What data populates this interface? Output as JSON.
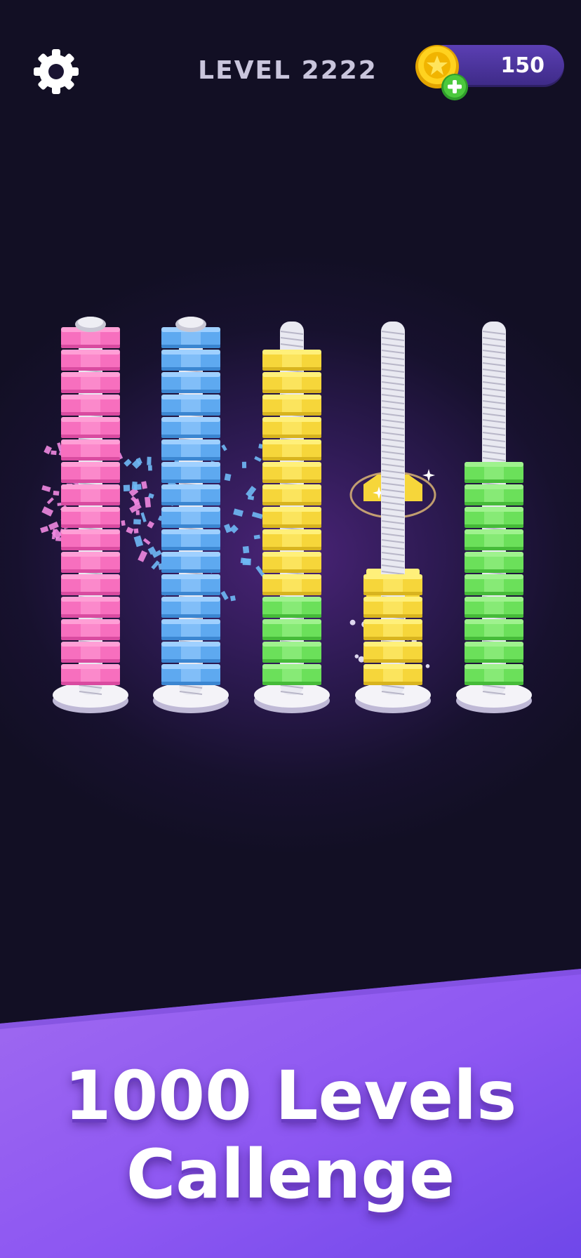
{
  "hud": {
    "level_label": "LEVEL",
    "level_number": "2222",
    "coins": "150",
    "settings_icon": "gear-icon",
    "coin_icon": "star-coin-icon",
    "add_icon": "plus-icon"
  },
  "colors": {
    "pink": "#f76fbe",
    "blue": "#5ea9f0",
    "yellow": "#f6d63a",
    "green": "#6be05a",
    "rod": "#e9e9f1"
  },
  "poles": [
    {
      "name": "pole-1",
      "stack": [
        "pink",
        "pink",
        "pink",
        "pink",
        "pink",
        "pink",
        "pink",
        "pink",
        "pink",
        "pink",
        "pink",
        "pink",
        "pink",
        "pink",
        "pink",
        "pink"
      ]
    },
    {
      "name": "pole-2",
      "stack": [
        "blue",
        "blue",
        "blue",
        "blue",
        "blue",
        "blue",
        "blue",
        "blue",
        "blue",
        "blue",
        "blue",
        "blue",
        "blue",
        "blue",
        "blue",
        "blue"
      ]
    },
    {
      "name": "pole-3",
      "stack": [
        "green",
        "green",
        "green",
        "green",
        "yellow",
        "yellow",
        "yellow",
        "yellow",
        "yellow",
        "yellow",
        "yellow",
        "yellow",
        "yellow",
        "yellow",
        "yellow"
      ]
    },
    {
      "name": "pole-4",
      "stack": [
        "yellow",
        "yellow",
        "yellow",
        "yellow",
        "yellow"
      ]
    },
    {
      "name": "pole-5",
      "stack": [
        "green",
        "green",
        "green",
        "green",
        "green",
        "green",
        "green",
        "green",
        "green",
        "green"
      ]
    }
  ],
  "lifted_nut": "yellow",
  "banner": {
    "line1": "1000 Levels",
    "line2": "Callenge"
  }
}
